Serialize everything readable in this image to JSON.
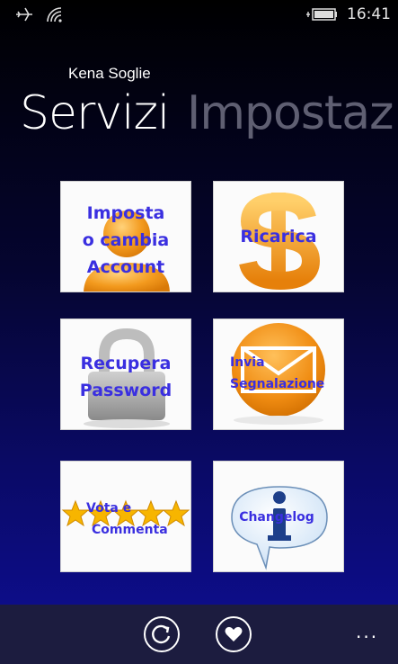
{
  "status_bar": {
    "icons": [
      "airplane-icon",
      "wifi-icon",
      "battery-icon"
    ],
    "time": "16:41"
  },
  "header": {
    "app_title": "Kena Soglie",
    "pivot_active": "Servizi",
    "pivot_next": "Impostaz"
  },
  "tiles": {
    "account": {
      "lines": [
        "Imposta",
        "o cambia",
        "Account"
      ],
      "icon": "user-icon"
    },
    "ricarica": {
      "label": "Ricarica",
      "icon": "dollar-icon"
    },
    "password": {
      "lines": [
        "Recupera",
        "Password"
      ],
      "icon": "padlock-icon"
    },
    "segnalazione": {
      "lines": [
        "Invia",
        "Segnalazione"
      ],
      "icon": "mail-icon"
    },
    "vota": {
      "lines": [
        "Vota e",
        "Commenta"
      ],
      "icon": "stars-icon"
    },
    "changelog": {
      "label": "Changelog",
      "icon": "info-icon"
    }
  },
  "app_bar": {
    "buttons": [
      "refresh-icon",
      "heart-icon"
    ],
    "more": "..."
  },
  "colors": {
    "tile_text": "#3a2fe0",
    "accent_orange": "#f39a1e",
    "app_bar_bg": "#1c1c3f"
  }
}
